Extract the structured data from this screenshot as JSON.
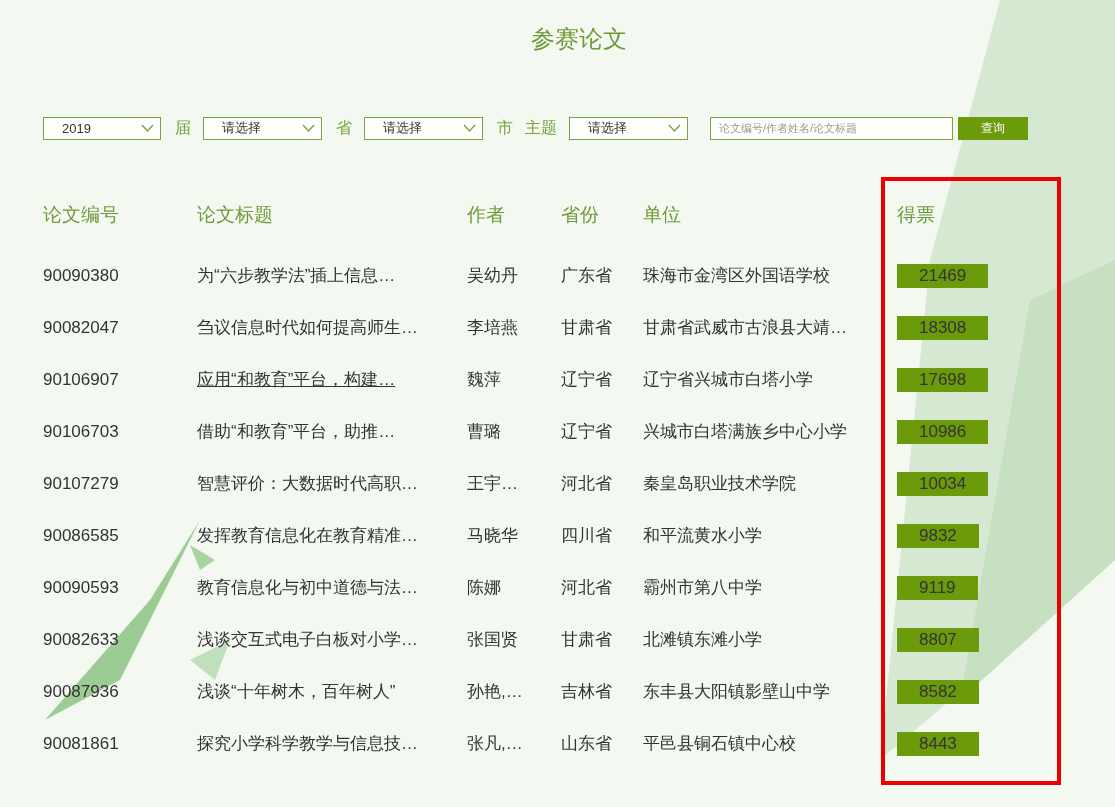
{
  "page_title": "参赛论文",
  "filters": [
    {
      "kind": "select",
      "value": "2019"
    },
    {
      "kind": "label",
      "text": "届"
    },
    {
      "kind": "select",
      "value": "请选择"
    },
    {
      "kind": "label",
      "text": "省"
    },
    {
      "kind": "select",
      "value": "请选择"
    },
    {
      "kind": "label",
      "text": "市"
    },
    {
      "kind": "label",
      "text": "主题"
    },
    {
      "kind": "select",
      "value": "请选择"
    },
    {
      "kind": "search",
      "placeholder": "论文编号/作者姓名/论文标题"
    },
    {
      "kind": "button",
      "text": "查询"
    }
  ],
  "table": {
    "columns": [
      {
        "label": "论文编号",
        "highlighted": false
      },
      {
        "label": "论文标题",
        "highlighted": false
      },
      {
        "label": "作者",
        "highlighted": false
      },
      {
        "label": "省份",
        "highlighted": false
      },
      {
        "label": "单位",
        "highlighted": false
      },
      {
        "label": "得票",
        "highlighted": true
      }
    ],
    "rows": [
      {
        "id": "90090380",
        "title": "为“六步教学法”插上信息…",
        "author": "吴幼丹",
        "province": "广东省",
        "unit": "珠海市金湾区外国语学校",
        "votes": "21469",
        "hovered": false
      },
      {
        "id": "90082047",
        "title": "刍议信息时代如何提高师生…",
        "author": "李培燕",
        "province": "甘肃省",
        "unit": "甘肃省武威市古浪县大靖…",
        "votes": "18308",
        "hovered": false
      },
      {
        "id": "90106907",
        "title": "应用“和教育”平台，构建…",
        "author": "魏萍",
        "province": "辽宁省",
        "unit": "辽宁省兴城市白塔小学",
        "votes": "17698",
        "hovered": true
      },
      {
        "id": "90106703",
        "title": "借助“和教育”平台，助推…",
        "author": "曹璐",
        "province": "辽宁省",
        "unit": "兴城市白塔满族乡中心小学",
        "votes": "10986",
        "hovered": false
      },
      {
        "id": "90107279",
        "title": "智慧评价：大数据时代高职…",
        "author": "王宇…",
        "province": "河北省",
        "unit": "秦皇岛职业技术学院",
        "votes": "10034",
        "hovered": false
      },
      {
        "id": "90086585",
        "title": "发挥教育信息化在教育精准…",
        "author": "马晓华",
        "province": "四川省",
        "unit": "和平流黄水小学",
        "votes": "9832",
        "hovered": false
      },
      {
        "id": "90090593",
        "title": "教育信息化与初中道德与法…",
        "author": "陈娜",
        "province": "河北省",
        "unit": "霸州市第八中学",
        "votes": "9119",
        "hovered": false
      },
      {
        "id": "90082633",
        "title": "浅谈交互式电子白板对小学…",
        "author": "张国贤",
        "province": "甘肃省",
        "unit": "北滩镇东滩小学",
        "votes": "8807",
        "hovered": false
      },
      {
        "id": "90087936",
        "title": "浅谈“十年树木，百年树人”",
        "author": "孙艳,…",
        "province": "吉林省",
        "unit": "东丰县大阳镇影壁山中学",
        "votes": "8582",
        "hovered": false
      },
      {
        "id": "90081861",
        "title": "探究小学科学教学与信息技…",
        "author": "张凡,…",
        "province": "山东省",
        "unit": "平邑县铜石镇中心校",
        "votes": "8443",
        "hovered": false
      }
    ]
  }
}
